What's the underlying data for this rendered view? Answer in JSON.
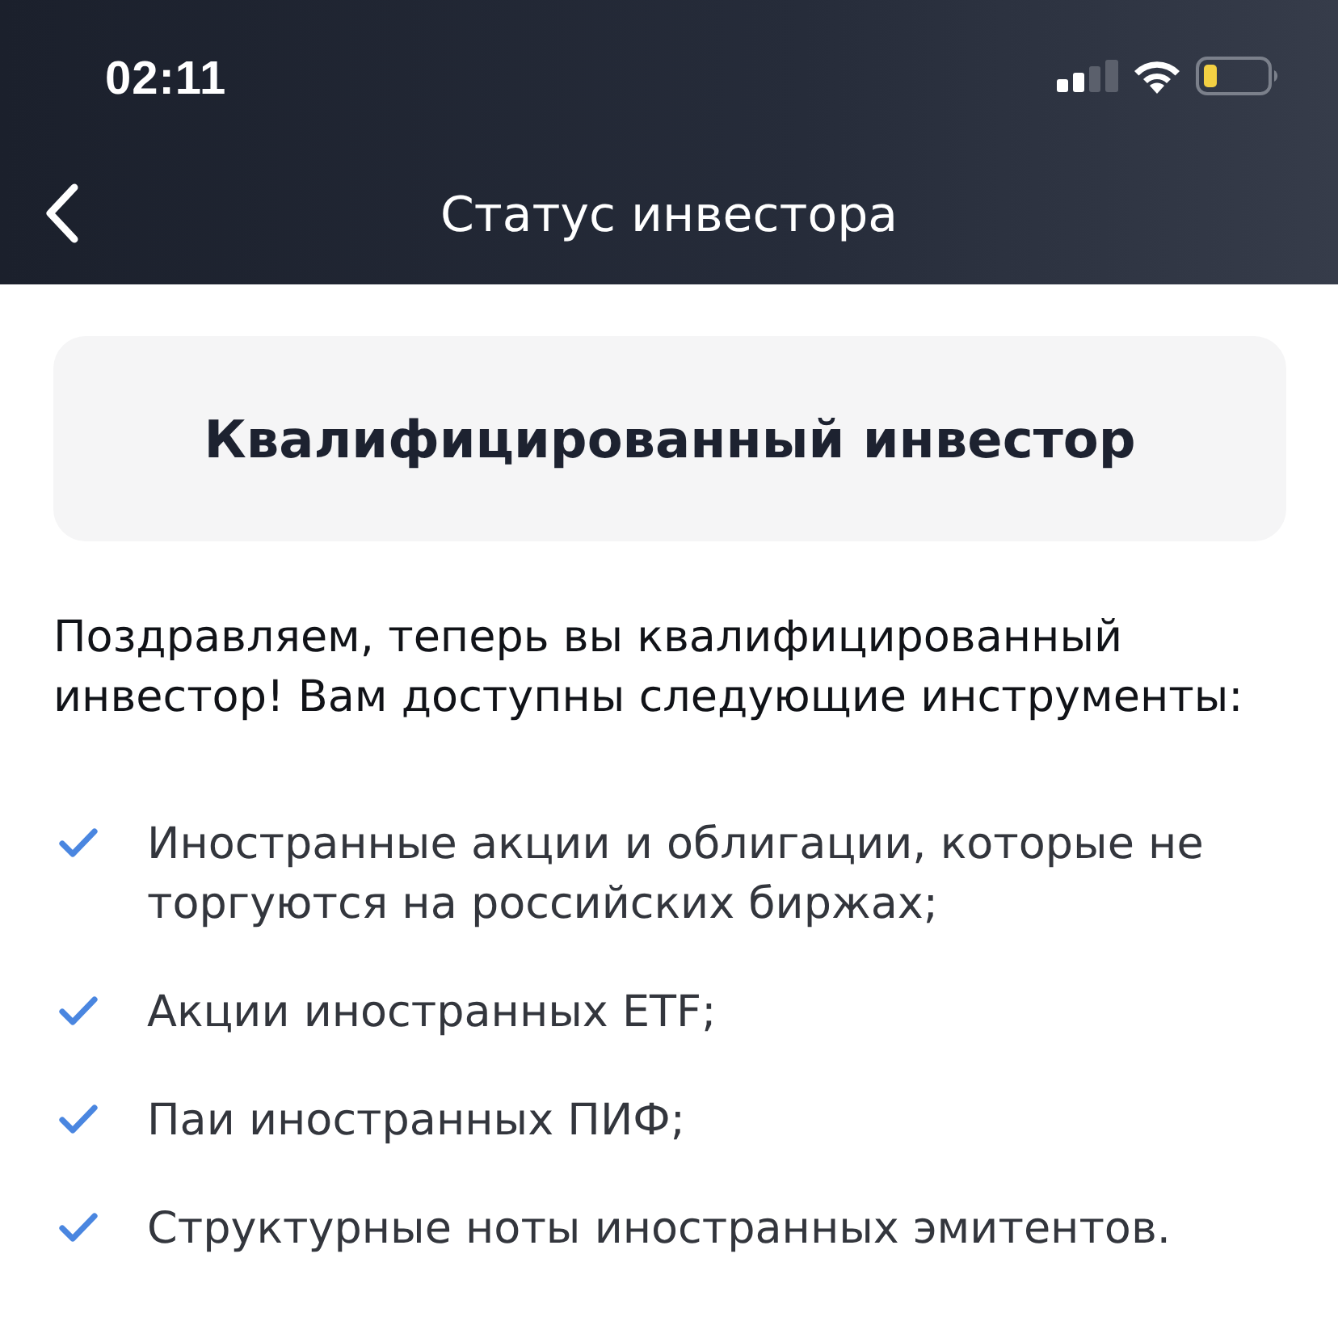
{
  "status_bar": {
    "time": "02:11"
  },
  "nav_bar": {
    "title": "Статус инвестора"
  },
  "status_card": {
    "title": "Квалифицированный инвестор"
  },
  "message": "Поздравляем, теперь вы квалифицированный инвестор! Вам доступны следующие инструменты:",
  "instruments": [
    {
      "text": "Иностранные акции и облигации, которые не торгуются на российских биржах;"
    },
    {
      "text": "Акции иностранных ETF;"
    },
    {
      "text": "Паи иностранных ПИФ;"
    },
    {
      "text": "Структурные ноты иностранных эмитентов."
    }
  ]
}
